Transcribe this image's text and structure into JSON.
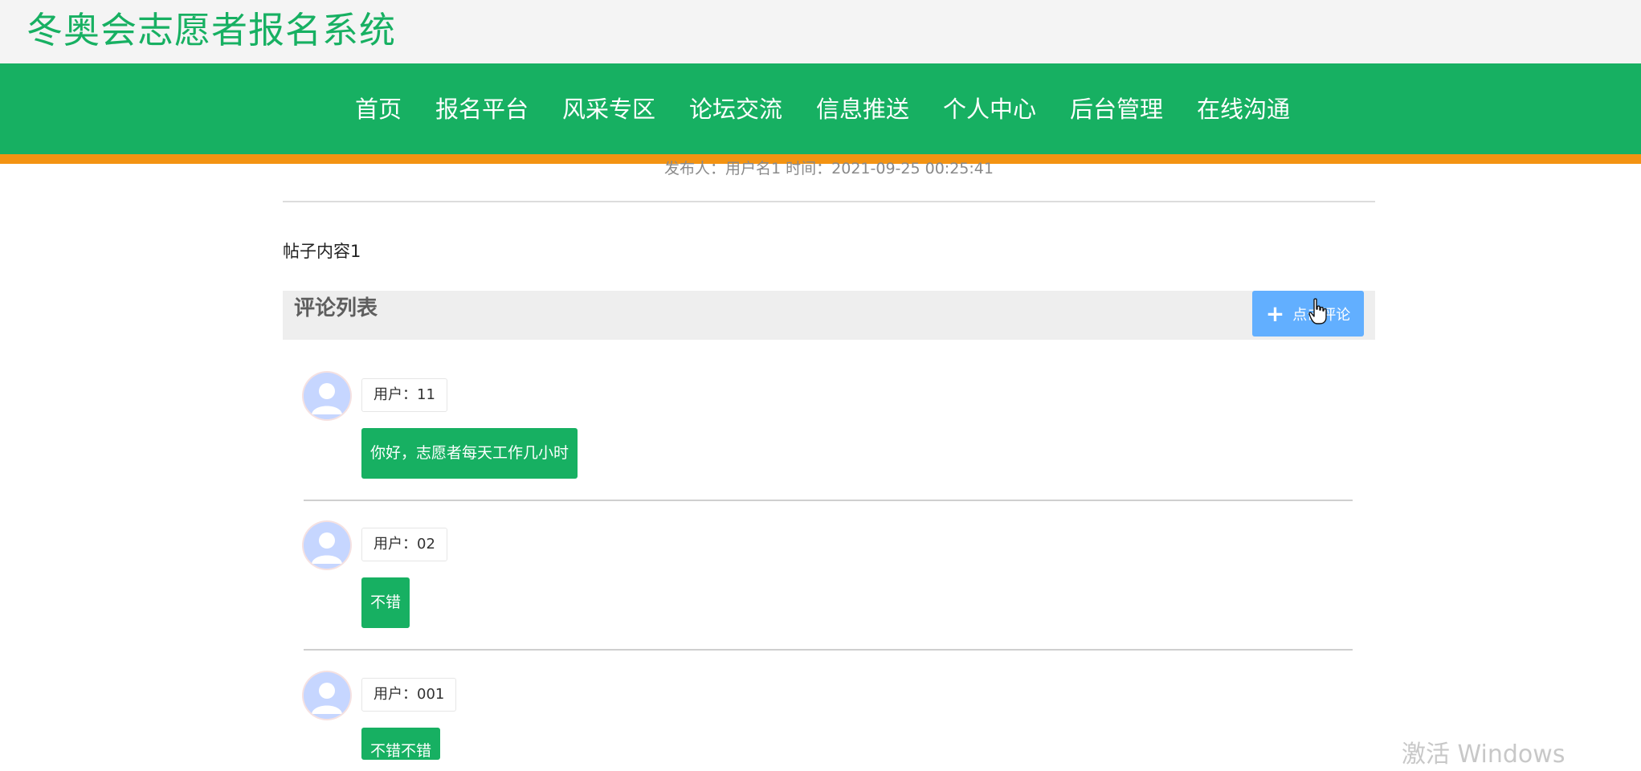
{
  "header": {
    "site_title": "冬奥会志愿者报名系统"
  },
  "nav": {
    "items": [
      {
        "label": "首页"
      },
      {
        "label": "报名平台"
      },
      {
        "label": "风采专区"
      },
      {
        "label": "论坛交流"
      },
      {
        "label": "信息推送"
      },
      {
        "label": "个人中心"
      },
      {
        "label": "后台管理"
      },
      {
        "label": "在线沟通"
      }
    ]
  },
  "post": {
    "meta": "发布人：用户名1 时间：2021-09-25 00:25:41",
    "content": "帖子内容1"
  },
  "comments": {
    "title": "评论列表",
    "button_label": "点击评论",
    "items": [
      {
        "user": "用户：11",
        "text": "你好，志愿者每天工作几小时"
      },
      {
        "user": "用户：02",
        "text": "不错"
      },
      {
        "user": "用户：001",
        "text": "不错不错"
      }
    ]
  },
  "watermark": "激活 Windows",
  "colors": {
    "brand_green": "#17b062",
    "accent_orange": "#f39312",
    "button_blue": "#62afff"
  }
}
